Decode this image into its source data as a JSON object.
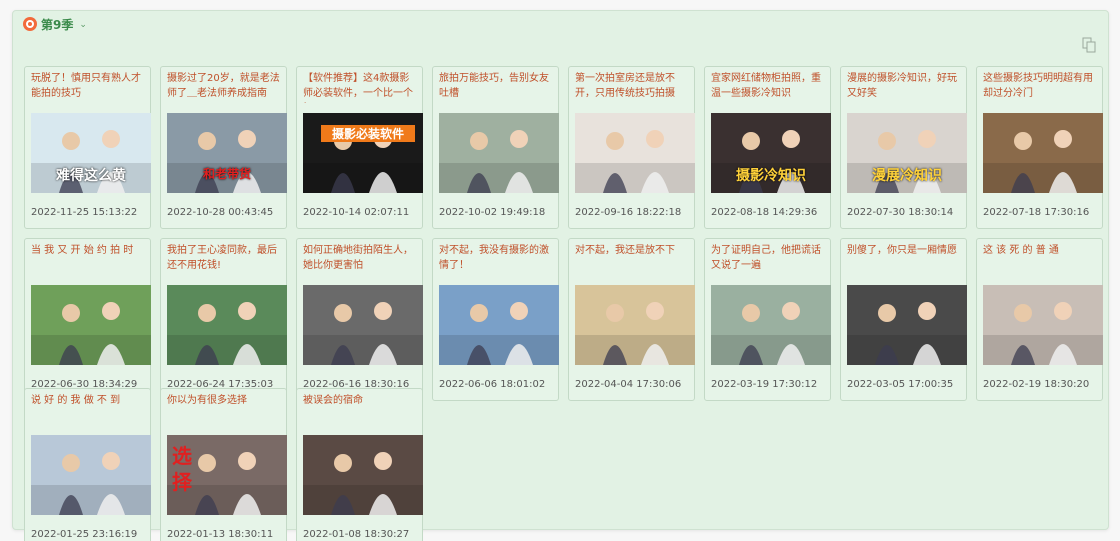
{
  "header": {
    "title": "第9季",
    "logo_icon": "app-logo-icon",
    "chevron_icon": "chevron-down-icon"
  },
  "toolbar": {
    "corner_icon": "copy-icon"
  },
  "videos": [
    {
      "title": "玩脱了！慎用只有熟人才能拍的技巧",
      "date": "2022-11-25 15:13:22",
      "overlay": "难得这么黄",
      "bg": "#d8e8ef"
    },
    {
      "title": "摄影过了20岁，就是老法师了＿老法师养成指南",
      "date": "2022-10-28 00:43:45",
      "overlay": "和老带货",
      "bg": "#8a9aa6"
    },
    {
      "title": "【软件推荐】这4款摄影师必装软件，一个比一个好用",
      "date": "2022-10-14 02:07:11",
      "overlay": "摄影必装软件",
      "bg": "#1a1a1a"
    },
    {
      "title": "旅拍万能技巧，告别女友吐槽",
      "date": "2022-10-02 19:49:18",
      "overlay": "",
      "bg": "#9fb0a0"
    },
    {
      "title": "第一次拍室房还是放不开，只用传统技巧拍摄",
      "date": "2022-09-16 18:22:18",
      "overlay": "",
      "bg": "#e8e2dc"
    },
    {
      "title": "宜家网红储物柜拍照，重温一些摄影冷知识",
      "date": "2022-08-18 14:29:36",
      "overlay": "摄影冷知识",
      "bg": "#3a3030"
    },
    {
      "title": "漫展的摄影冷知识，好玩又好笑",
      "date": "2022-07-30 18:30:14",
      "overlay": "漫展冷知识",
      "bg": "#d9d4cf"
    },
    {
      "title": "这些摄影技巧明明超有用却过分冷门",
      "date": "2022-07-18 17:30:16",
      "overlay": "",
      "bg": "#8a6a4a"
    },
    {
      "title": "当 我 又 开 始 约 拍 时",
      "date": "2022-06-30 18:34:29",
      "overlay": "",
      "bg": "#6fa05a"
    },
    {
      "title": "我拍了王心凌同款，最后还不用花钱!",
      "date": "2022-06-24 17:35:03",
      "overlay": "",
      "bg": "#5a8a5a"
    },
    {
      "title": "如何正确地街拍陌生人，她比你更害怕",
      "date": "2022-06-16 18:30:16",
      "overlay": "",
      "bg": "#6a6a6a"
    },
    {
      "title": "对不起，我没有摄影的激情了！",
      "date": "2022-06-06 18:01:02",
      "overlay": "",
      "bg": "#7aa0c8"
    },
    {
      "title": "对不起，我还是放不下",
      "date": "2022-04-04 17:30:06",
      "overlay": "",
      "bg": "#d8c49a"
    },
    {
      "title": "为了证明自己，他把谎话又说了一遍",
      "date": "2022-03-19 17:30:12",
      "overlay": "",
      "bg": "#9ab0a0"
    },
    {
      "title": "别傻了，你只是一厢情愿",
      "date": "2022-03-05 17:00:35",
      "overlay": "",
      "bg": "#4a4a4a"
    },
    {
      "title": "这 该 死 的 普 通",
      "date": "2022-02-19 18:30:20",
      "overlay": "",
      "bg": "#c8beb6"
    },
    {
      "title": "说 好 的 我 做 不 到",
      "date": "2022-01-25 23:16:19",
      "overlay": "",
      "bg": "#b8c8d8"
    },
    {
      "title": "你以为有很多选择",
      "date": "2022-01-13 18:30:11",
      "overlay": "选择",
      "bg": "#7a6a66"
    },
    {
      "title": "被误会的宿命",
      "date": "2022-01-08 18:30:27",
      "overlay": "",
      "bg": "#5a4a44"
    }
  ]
}
